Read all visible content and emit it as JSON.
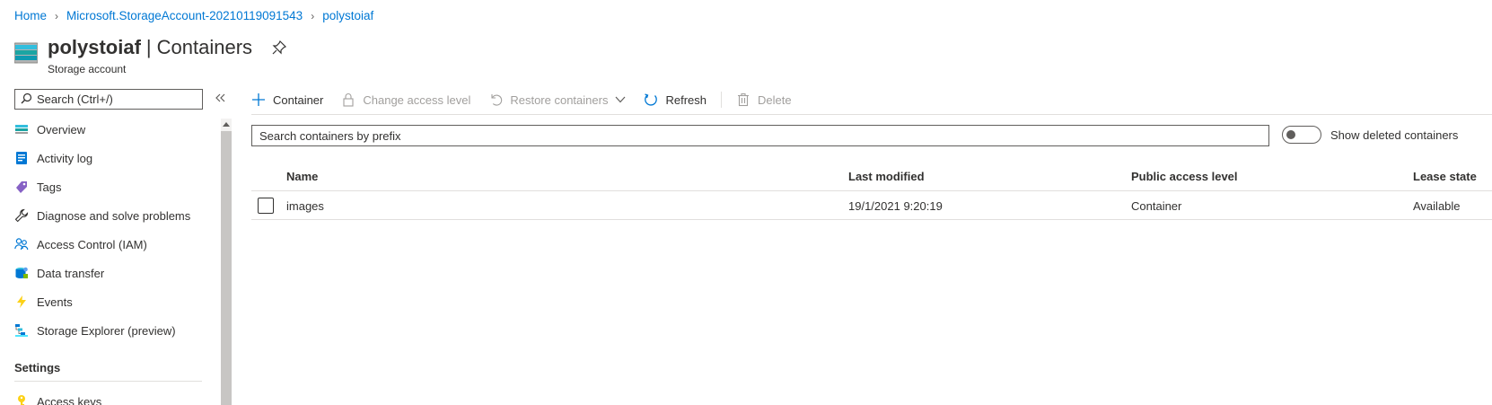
{
  "breadcrumb": {
    "home": "Home",
    "resource_group": "Microsoft.StorageAccount-20210119091543",
    "account": "polystoiaf"
  },
  "header": {
    "name": "polystoiaf",
    "separator": "|",
    "section": "Containers",
    "subtitle": "Storage account"
  },
  "sidebar": {
    "search_placeholder": "Search (Ctrl+/)",
    "items": [
      {
        "label": "Overview",
        "icon": "storage-icon"
      },
      {
        "label": "Activity log",
        "icon": "activity-log-icon"
      },
      {
        "label": "Tags",
        "icon": "tag-icon"
      },
      {
        "label": "Diagnose and solve problems",
        "icon": "wrench-icon"
      },
      {
        "label": "Access Control (IAM)",
        "icon": "people-icon"
      },
      {
        "label": "Data transfer",
        "icon": "data-transfer-icon"
      },
      {
        "label": "Events",
        "icon": "lightning-icon"
      },
      {
        "label": "Storage Explorer (preview)",
        "icon": "storage-explorer-icon"
      }
    ],
    "section_settings": "Settings",
    "access_keys": "Access keys"
  },
  "toolbar": {
    "container": "Container",
    "change_access": "Change access level",
    "restore": "Restore containers",
    "refresh": "Refresh",
    "delete": "Delete"
  },
  "filter": {
    "placeholder": "Search containers by prefix",
    "toggle_label": "Show deleted containers",
    "toggle_on": false
  },
  "table": {
    "columns": [
      "Name",
      "Last modified",
      "Public access level",
      "Lease state"
    ],
    "rows": [
      {
        "name": "images",
        "modified": "19/1/2021 9:20:19",
        "access": "Container",
        "lease": "Available"
      }
    ]
  },
  "colors": {
    "accent": "#0078d4",
    "text": "#323130",
    "disabled": "#a19f9d"
  }
}
